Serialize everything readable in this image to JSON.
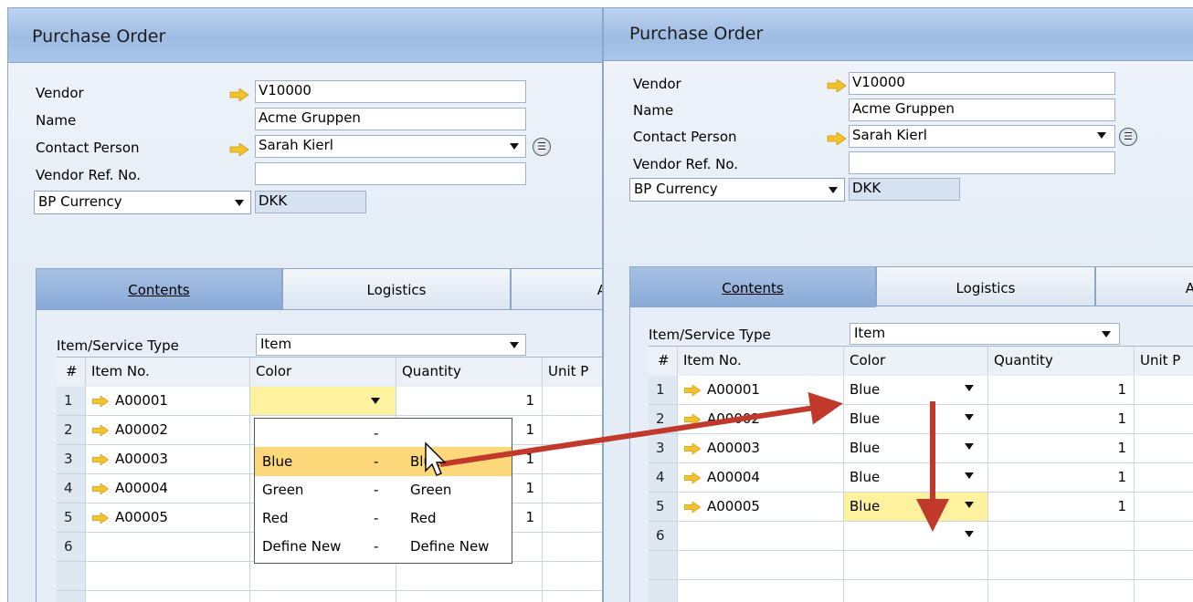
{
  "windows": [
    {
      "title": "Purchase Order",
      "header": {
        "vendor_label": "Vendor",
        "vendor_value": "V10000",
        "name_label": "Name",
        "name_value": "Acme Gruppen",
        "contact_label": "Contact Person",
        "contact_value": "Sarah Kierl",
        "ref_label": "Vendor Ref. No.",
        "ref_value": "",
        "currency_select": "BP Currency",
        "currency_value": "DKK"
      },
      "tabs": [
        "Contents",
        "Logistics",
        "A"
      ],
      "type_label": "Item/Service Type",
      "type_value": "Item",
      "columns": [
        "#",
        "Item No.",
        "Color",
        "Quantity",
        "Unit P"
      ],
      "rows": [
        {
          "num": "1",
          "item": "A00001",
          "color": "",
          "qty": "1"
        },
        {
          "num": "2",
          "item": "A00002",
          "color": "",
          "qty": "1"
        },
        {
          "num": "3",
          "item": "A00003",
          "color": "",
          "qty": "1"
        },
        {
          "num": "4",
          "item": "A00004",
          "color": "",
          "qty": "1"
        },
        {
          "num": "5",
          "item": "A00005",
          "color": "",
          "qty": "1"
        },
        {
          "num": "6",
          "item": "",
          "color": "",
          "qty": ""
        }
      ],
      "dropdown": [
        {
          "left": "",
          "sep": "-",
          "right": ""
        },
        {
          "left": "Blue",
          "sep": "-",
          "right": "Blue",
          "highlight": true
        },
        {
          "left": "Green",
          "sep": "-",
          "right": "Green"
        },
        {
          "left": "Red",
          "sep": "-",
          "right": "Red"
        },
        {
          "left": "Define New",
          "sep": "-",
          "right": "Define New"
        }
      ]
    },
    {
      "title": "Purchase Order",
      "header": {
        "vendor_label": "Vendor",
        "vendor_value": "V10000",
        "name_label": "Name",
        "name_value": "Acme Gruppen",
        "contact_label": "Contact Person",
        "contact_value": "Sarah Kierl",
        "ref_label": "Vendor Ref. No.",
        "ref_value": "",
        "currency_select": "BP Currency",
        "currency_value": "DKK"
      },
      "tabs": [
        "Contents",
        "Logistics",
        "A"
      ],
      "type_label": "Item/Service Type",
      "type_value": "Item",
      "columns": [
        "#",
        "Item No.",
        "Color",
        "Quantity",
        "Unit P"
      ],
      "rows": [
        {
          "num": "1",
          "item": "A00001",
          "color": "Blue",
          "qty": "1"
        },
        {
          "num": "2",
          "item": "A00002",
          "color": "Blue",
          "qty": "1"
        },
        {
          "num": "3",
          "item": "A00003",
          "color": "Blue",
          "qty": "1"
        },
        {
          "num": "4",
          "item": "A00004",
          "color": "Blue",
          "qty": "1"
        },
        {
          "num": "5",
          "item": "A00005",
          "color": "Blue",
          "qty": "1"
        },
        {
          "num": "6",
          "item": "",
          "color": "",
          "qty": ""
        }
      ]
    }
  ],
  "colors": {
    "link_arrow": "#f5c22a",
    "annotation_arrow": "#c0392b",
    "highlight": "#fcd87a",
    "active_cell": "#fff29e"
  }
}
